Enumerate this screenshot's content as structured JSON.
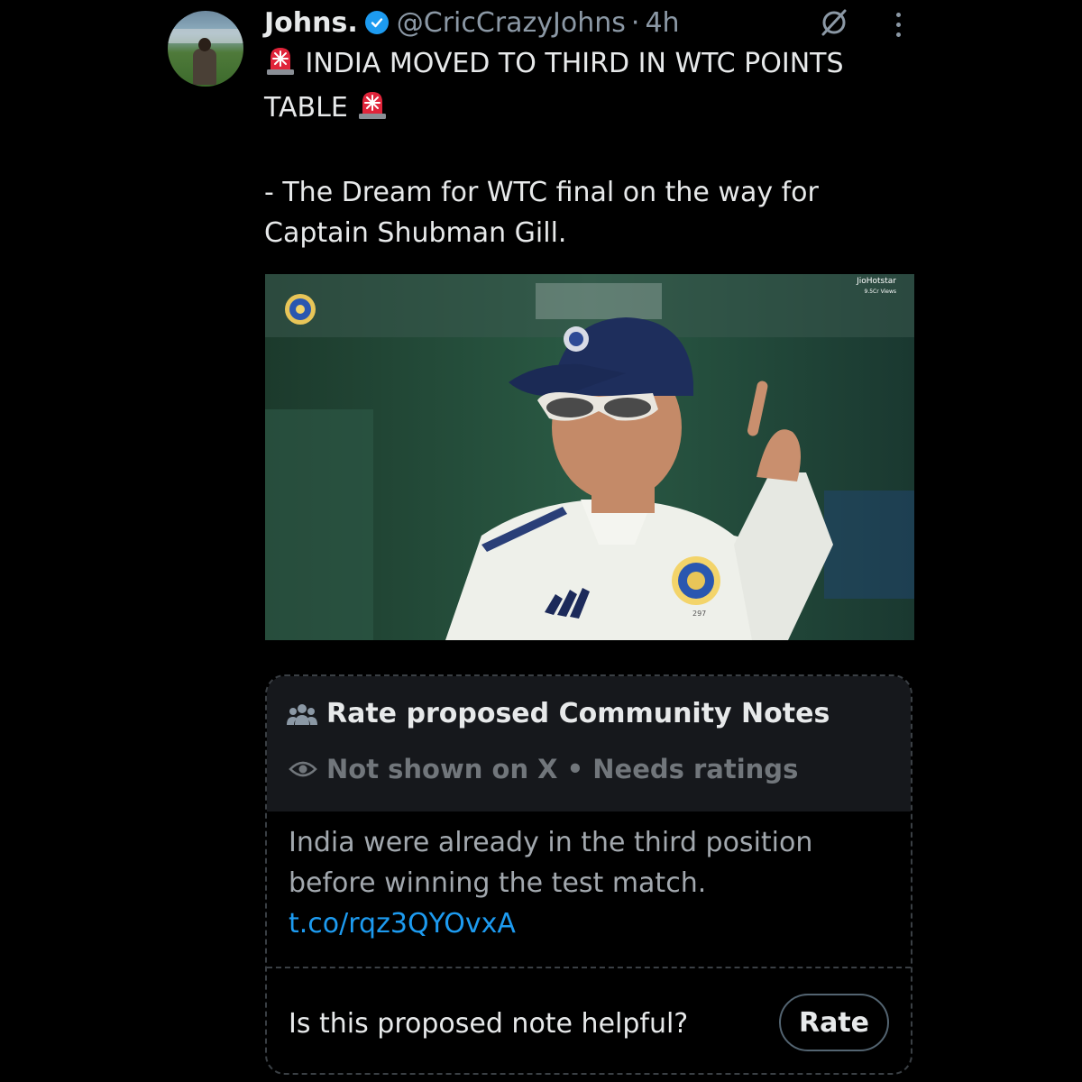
{
  "tweet": {
    "display_name": "Johns.",
    "handle": "@CricCrazyJohns",
    "separator": "·",
    "time": "4h",
    "line1": "INDIA MOVED TO THIRD IN WTC POINTS",
    "line2": "TABLE",
    "line3": "- The Dream for WTC final on the way for",
    "line4": "Captain Shubman Gill."
  },
  "media": {
    "watermark_brand": "JioHotstar",
    "watermark_views": "9.5Cr Views",
    "jersey_number": "297"
  },
  "community_notes": {
    "title": "Rate proposed Community Notes",
    "status": "Not shown on X • Needs ratings",
    "note_line1": "India were already in the third position",
    "note_line2": "before winning the test match.",
    "note_link": "t.co/rqz3QYOvxA",
    "question": "Is this proposed note helpful?",
    "rate_label": "Rate"
  },
  "icons": [
    "verified-badge-icon",
    "grok-icon",
    "more-options-icon",
    "siren-icon",
    "community-people-icon",
    "eye-icon"
  ],
  "colors": {
    "accent": "#1d9bf0",
    "muted": "#71767b",
    "background": "#000000"
  }
}
